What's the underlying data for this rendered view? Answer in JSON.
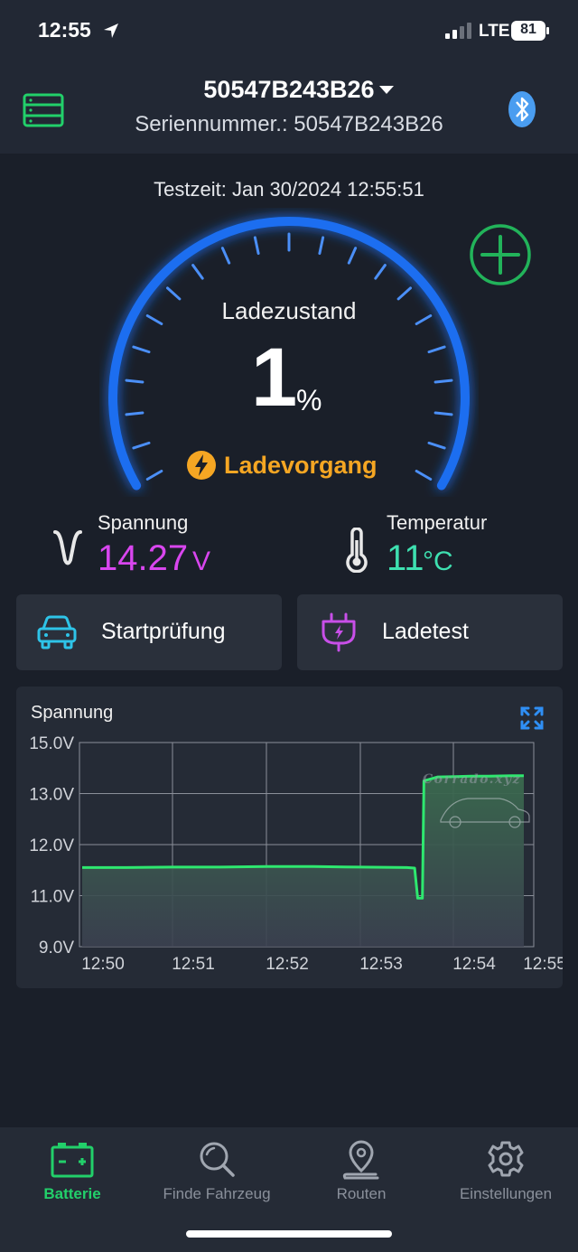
{
  "status_bar": {
    "time": "12:55",
    "network": "LTE",
    "battery": "81"
  },
  "header": {
    "device": "50547B243B26",
    "serial": "Seriennummer.: 50547B243B26"
  },
  "test_time": "Testzeit: Jan 30/2024 12:55:51",
  "gauge": {
    "label": "Ladezustand",
    "value": "1",
    "unit": "%",
    "state": "Ladevorgang"
  },
  "readings": {
    "voltage": {
      "label": "Spannung",
      "value": "14.27",
      "unit": "V",
      "color": "#d946ef"
    },
    "temperature": {
      "label": "Temperatur",
      "value": "11",
      "unit": "°C",
      "color": "#3ee0b0"
    }
  },
  "actions": {
    "start_test": "Startprüfung",
    "charge_test": "Ladetest"
  },
  "chart": {
    "title": "Spannung",
    "watermark": "Corrado.xyz"
  },
  "chart_data": {
    "type": "line",
    "title": "Spannung",
    "x_ticks": [
      "12:50",
      "12:51",
      "12:52",
      "12:53",
      "12:54",
      "12:55"
    ],
    "y_ticks": [
      "15.0V",
      "13.0V",
      "12.0V",
      "11.0V",
      "9.0V"
    ],
    "series": [
      {
        "color": "#2ee86f",
        "points": [
          [
            "12:50:00",
            11.55
          ],
          [
            "12:50:30",
            11.55
          ],
          [
            "12:51:00",
            11.56
          ],
          [
            "12:51:30",
            11.56
          ],
          [
            "12:52:00",
            11.57
          ],
          [
            "12:52:30",
            11.57
          ],
          [
            "12:53:00",
            11.56
          ],
          [
            "12:53:30",
            11.55
          ],
          [
            "12:53:35",
            11.54
          ],
          [
            "12:53:37",
            10.9
          ],
          [
            "12:53:40",
            10.9
          ],
          [
            "12:53:41",
            13.5
          ],
          [
            "12:53:50",
            13.65
          ],
          [
            "12:54:15",
            13.68
          ],
          [
            "12:54:30",
            13.68
          ],
          [
            "12:54:50",
            13.7
          ],
          [
            "12:55:00",
            13.7
          ]
        ]
      }
    ]
  },
  "tabs": [
    {
      "label": "Batterie",
      "active": true
    },
    {
      "label": "Finde Fahrzeug",
      "active": false
    },
    {
      "label": "Routen",
      "active": false
    },
    {
      "label": "Einstellungen",
      "active": false
    }
  ]
}
